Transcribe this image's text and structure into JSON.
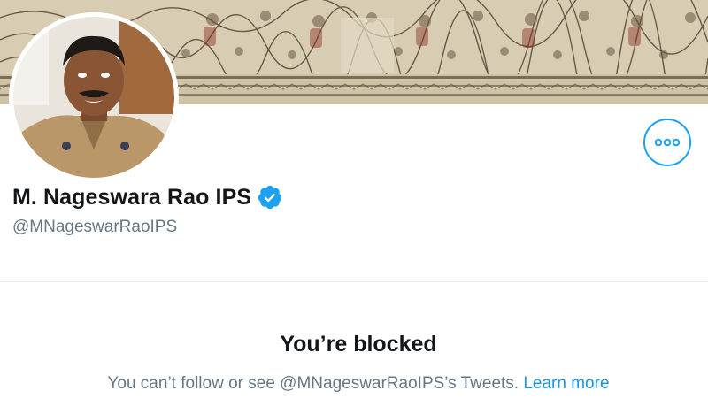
{
  "profile": {
    "display_name": "M. Nageswara Rao IPS",
    "handle": "@MNageswarRaoIPS",
    "verified_icon": "verified-badge-icon",
    "more_icon": "more-options-icon"
  },
  "blocked": {
    "title": "You’re blocked",
    "message": "You can’t follow or see @MNageswarRaoIPS’s Tweets.",
    "learn_more_label": "Learn more"
  },
  "colors": {
    "accent": "#1da1f2",
    "link": "#1b95e0",
    "secondary_text": "#657786",
    "primary_text": "#14171a"
  }
}
